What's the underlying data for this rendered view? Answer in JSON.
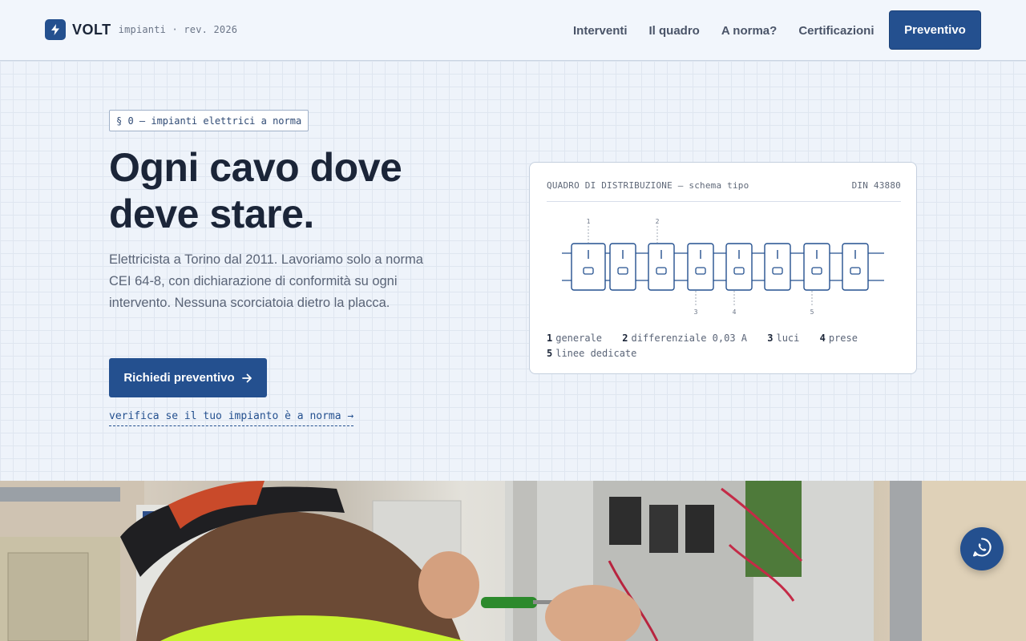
{
  "header": {
    "brand_name": "VOLT",
    "brand_tag": "impianti · rev. 2026",
    "nav": [
      "Interventi",
      "Il quadro",
      "A norma?",
      "Certificazioni"
    ],
    "cta_label": "Preventivo"
  },
  "hero": {
    "section_tag": "§ 0 — impianti elettrici a norma",
    "title": "Ogni cavo dove deve stare.",
    "lead": "Elettricista a Torino dal 2011. Lavoriamo solo a norma CEI 64-8, con dichiarazione di conformità su ogni intervento. Nessuna scorciatoia dietro la placca.",
    "primary_cta": "Richiedi preventivo",
    "secondary_link": "verifica se il tuo impianto è a norma →"
  },
  "panel": {
    "title": "QUADRO DI DISTRIBUZIONE — schema tipo",
    "code": "DIN 43880",
    "module_count": 8,
    "callouts_top": [
      "1",
      "2"
    ],
    "callouts_bottom": [
      "3",
      "4",
      "5"
    ],
    "legend": [
      {
        "num": "1",
        "label": "generale"
      },
      {
        "num": "2",
        "label": "differenziale 0,03 A"
      },
      {
        "num": "3",
        "label": "luci"
      },
      {
        "num": "4",
        "label": "prese"
      },
      {
        "num": "5",
        "label": "linee dedicate"
      }
    ]
  },
  "photo": {
    "alt_subject": "electrician working on distribution panel"
  },
  "colors": {
    "accent": "#24508f",
    "ink": "#1b2538",
    "muted": "#5a6477",
    "background": "#eef3fa"
  },
  "icons": {
    "brand": "bolt-icon",
    "cta_arrow": "arrow-right-icon",
    "chat": "whatsapp-icon"
  }
}
